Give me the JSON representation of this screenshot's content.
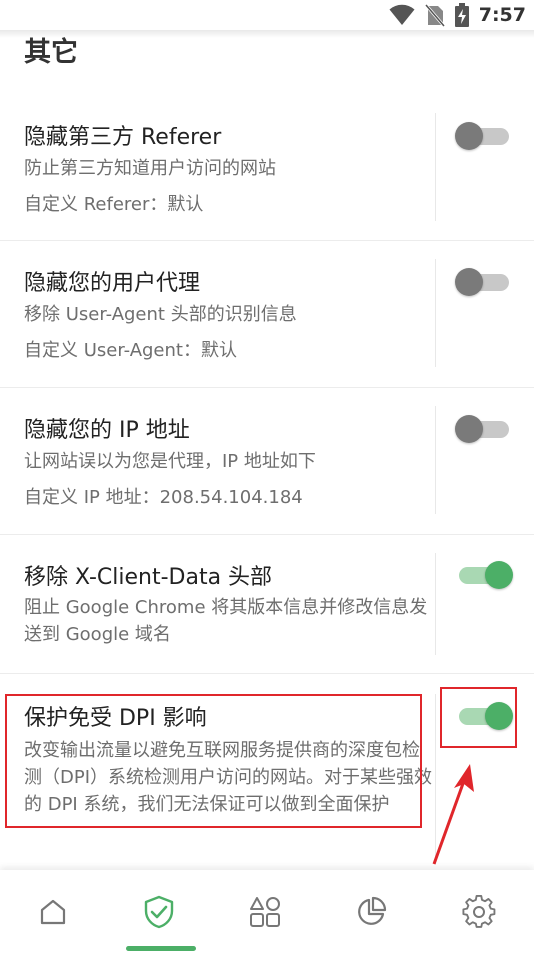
{
  "status_bar": {
    "time": "7:57",
    "icons": [
      "wifi-icon",
      "no-sim-icon",
      "battery-charging-icon"
    ]
  },
  "section": {
    "title": "其它"
  },
  "settings": [
    {
      "title": "隐藏第三方 Referer",
      "description": "防止第三方知道用户访问的网站",
      "custom": "自定义 Referer：默认",
      "enabled": false
    },
    {
      "title": "隐藏您的用户代理",
      "description": "移除 User-Agent 头部的识别信息",
      "custom": "自定义 User-Agent：默认",
      "enabled": false
    },
    {
      "title": "隐藏您的 IP 地址",
      "description": "让网站误以为您是代理，IP 地址如下",
      "custom": "自定义 IP 地址：208.54.104.184",
      "enabled": false
    },
    {
      "title": "移除 X-Client-Data 头部",
      "description": "阻止 Google Chrome 将其版本信息并修改信息发送到 Google 域名",
      "enabled": true
    },
    {
      "title": "保护免受 DPI 影响",
      "description": "改变输出流量以避免互联网服务提供商的深度包检测（DPI）系统检测用户访问的网站。对于某些强效的 DPI 系统，我们无法保证可以做到全面保护",
      "enabled": true
    }
  ],
  "bottom_nav": {
    "items": [
      "home-icon",
      "shield-check-icon",
      "apps-grid-icon",
      "pie-chart-icon",
      "settings-gear-icon"
    ],
    "active_index": 1
  },
  "colors": {
    "accent": "#4caf67",
    "annotation": "#e0262b"
  }
}
